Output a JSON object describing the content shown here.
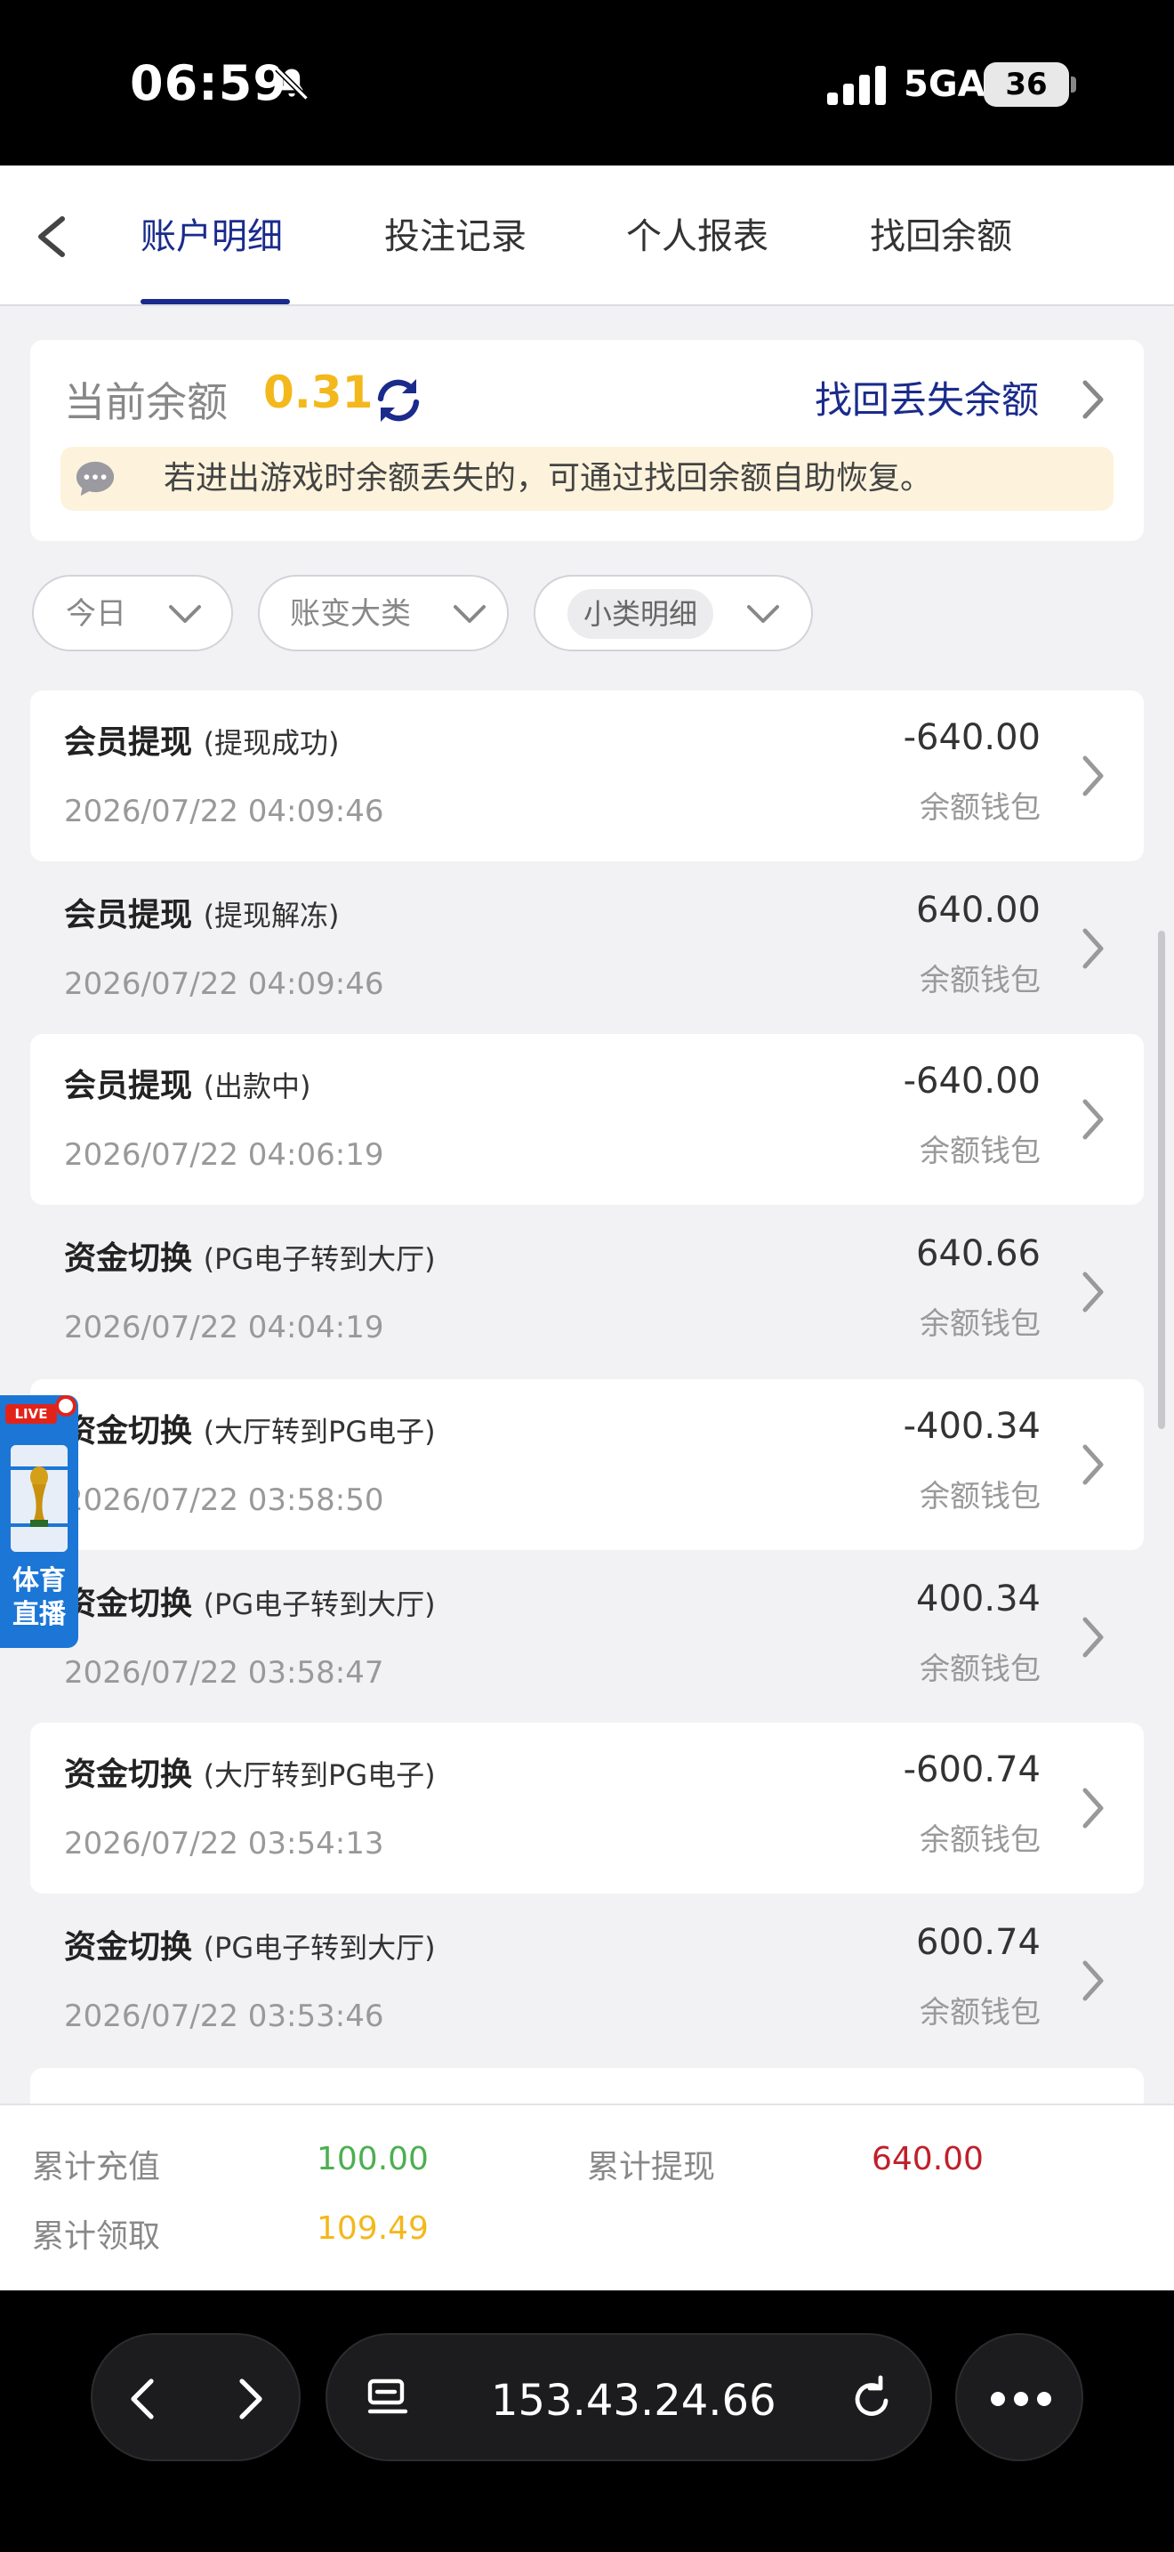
{
  "status_bar": {
    "time": "06:59",
    "network": "5GA",
    "battery": "36"
  },
  "tabs": [
    {
      "label": "账户明细",
      "active": true
    },
    {
      "label": "投注记录",
      "active": false
    },
    {
      "label": "个人报表",
      "active": false
    },
    {
      "label": "找回余额",
      "active": false
    }
  ],
  "balance": {
    "label": "当前余额",
    "value": "0.31",
    "recover_link": "找回丢失余额",
    "tip": "若进出游戏时余额丢失的，可通过找回余额自助恢复。"
  },
  "filters": {
    "date": "今日",
    "category": "账变大类",
    "subcategory": "小类明细"
  },
  "transactions": [
    {
      "title": "会员提现",
      "sub": "(提现成功)",
      "date": "2026/07/22 04:09:46",
      "amount": "-640.00",
      "wallet": "余额钱包"
    },
    {
      "title": "会员提现",
      "sub": "(提现解冻)",
      "date": "2026/07/22 04:09:46",
      "amount": "640.00",
      "wallet": "余额钱包"
    },
    {
      "title": "会员提现",
      "sub": "(出款中)",
      "date": "2026/07/22 04:06:19",
      "amount": "-640.00",
      "wallet": "余额钱包"
    },
    {
      "title": "资金切换",
      "sub": "(PG电子转到大厅)",
      "date": "2026/07/22 04:04:19",
      "amount": "640.66",
      "wallet": "余额钱包"
    },
    {
      "title": "资金切换",
      "sub": "(大厅转到PG电子)",
      "date": "2026/07/22 03:58:50",
      "amount": "-400.34",
      "wallet": "余额钱包"
    },
    {
      "title": "资金切换",
      "sub": "(PG电子转到大厅)",
      "date": "2026/07/22 03:58:47",
      "amount": "400.34",
      "wallet": "余额钱包"
    },
    {
      "title": "资金切换",
      "sub": "(大厅转到PG电子)",
      "date": "2026/07/22 03:54:13",
      "amount": "-600.74",
      "wallet": "余额钱包"
    },
    {
      "title": "资金切换",
      "sub": "(PG电子转到大厅)",
      "date": "2026/07/22 03:53:46",
      "amount": "600.74",
      "wallet": "余额钱包"
    }
  ],
  "floating_badge": {
    "live": "LIVE",
    "label_line1": "体育",
    "label_line2": "直播"
  },
  "summary": {
    "recharge_label": "累计充值",
    "recharge_value": "100.00",
    "withdraw_label": "累计提现",
    "withdraw_value": "640.00",
    "claim_label": "累计领取",
    "claim_value": "109.49"
  },
  "browser": {
    "url": "153.43.24.66"
  },
  "colors": {
    "accent": "#1a2b8c",
    "balance": "#f3b81c",
    "recharge": "#4caf50",
    "withdraw": "#c0202a",
    "claim": "#f3b81c"
  }
}
